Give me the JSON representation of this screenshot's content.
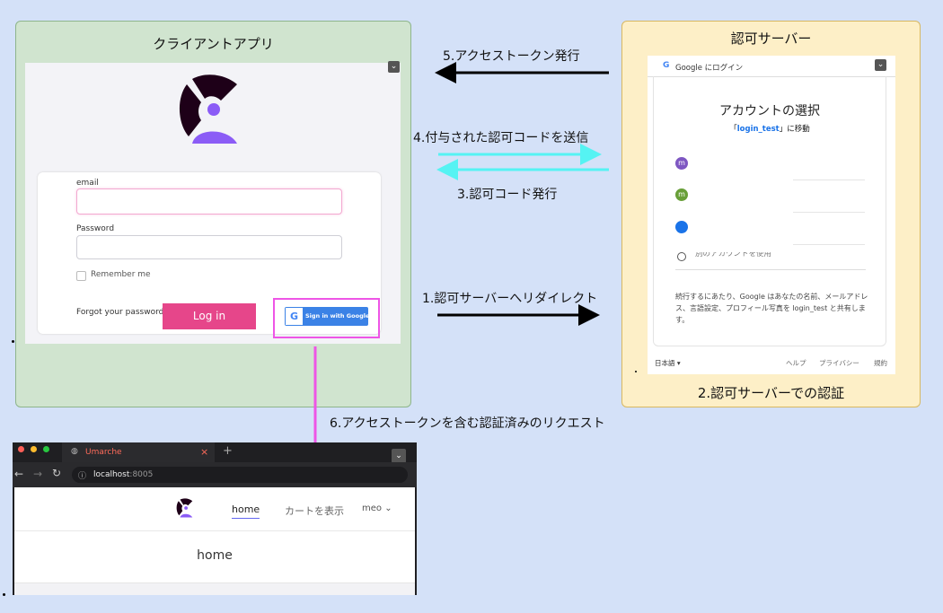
{
  "client_box": {
    "title": "クライアントアプリ"
  },
  "auth_box": {
    "title": "認可サーバー",
    "footer_label": "2.認可サーバーでの認証"
  },
  "arrows": {
    "step1": "1.認可サーバーへリダイレクト",
    "step3": "3.認可コード発行",
    "step4": "4.付与された認可コードを送信",
    "step5": "5.アクセストークン発行",
    "step6": "6.アクセストークンを含む認証済みのリクエスト"
  },
  "login_form": {
    "email_label": "email",
    "password_label": "Password",
    "remember_label": "Remember me",
    "forgot_label": "Forgot your password?",
    "login_button": "Log in",
    "google_button": "Sign in with Google"
  },
  "google_dialog": {
    "header": "Google にログイン",
    "title": "アカウントの選択",
    "subtitle_prefix": "「",
    "app_name": "login_test",
    "subtitle_suffix": "」に移動",
    "accounts": [
      "m",
      "m",
      ""
    ],
    "other_account": "別のアカウントを使用",
    "notice": "続行するにあたり、Google はあなたの名前、メールアドレス、言語設定、プロフィール写真を login_test と共有します。",
    "language": "日本語",
    "links": [
      "ヘルプ",
      "プライバシー",
      "規約"
    ]
  },
  "browser": {
    "tab_title": "Umarche",
    "url_prefix": "localhost",
    "url_suffix": ":8005",
    "nav_items": [
      "home",
      "カートを表示",
      "meo"
    ],
    "page_heading": "home"
  },
  "colors": {
    "client_bg": "#d0e4cf",
    "auth_bg": "#fdefc7",
    "page_bg": "#d4e1f8",
    "highlight": "#ee55e6",
    "cyan_arrow": "#55f3f3",
    "login_button": "#e6468a",
    "google_blue": "#3b82e6",
    "logo_purple": "#8b5cf6",
    "logo_dark": "#1e0018"
  }
}
